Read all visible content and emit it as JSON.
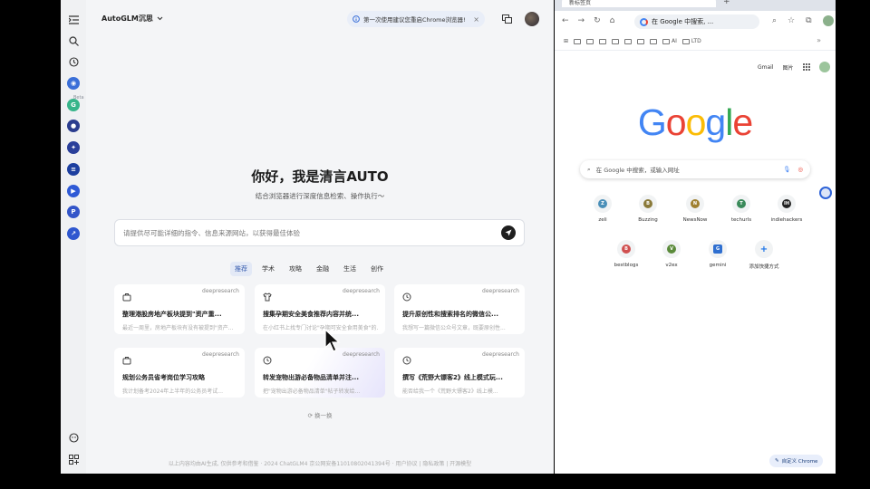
{
  "autoglm": {
    "title": "AutoGLM沉思",
    "notice": "第一次使用建议您重启Chrome浏览器!",
    "notice_close": "×",
    "rail_beta": "Beta",
    "hero_title": "你好，我是清言AUTO",
    "hero_sub": "结合浏览器进行深度信息检索、操作执行～",
    "prompt_placeholder": "请提供尽可能详细的指令、信息来源网站，以获得最佳体验",
    "categories": [
      "推荐",
      "学术",
      "攻略",
      "金融",
      "生活",
      "创作"
    ],
    "active_category": "推荐",
    "cards": [
      {
        "tag": "deepresearch",
        "icon": "briefcase-icon",
        "title": "整理港股房地产板块提到\"资产重...",
        "desc": "最近一周里，房地产板块有没有被提到\"资产..."
      },
      {
        "tag": "deepresearch",
        "icon": "shirt-icon",
        "title": "搜集孕期安全美食推荐内容并统...",
        "desc": "在小红书上找专门讨论\"孕期可安全食用美食\"的..."
      },
      {
        "tag": "deepresearch",
        "icon": "clock-icon",
        "title": "提升原创性和搜索排名的微信公...",
        "desc": "我想写一篇微信公众号文章，既要原创性..."
      },
      {
        "tag": "deepresearch",
        "icon": "briefcase-icon",
        "title": "规划公务员省考岗位学习攻略",
        "desc": "我计划备考2024年上半年的公务员考试..."
      },
      {
        "tag": "deepresearch",
        "icon": "clock-icon",
        "title": "转发宠物出游必备物品清单并注...",
        "desc": "把\"宠物出游必备物品清单\"帖子转发给..."
      },
      {
        "tag": "deepresearch",
        "icon": "clock-icon",
        "title": "撰写《荒野大镖客2》线上模式玩...",
        "desc": "能否给我一个《荒野大镖客2》线上模..."
      }
    ],
    "refresh_label": "换一换",
    "footer": "以上内容均由AI生成, 仅供参考和借鉴 · 2024 ChatGLM4 京公网安备11010802041394号 · 用户协议 | 隐私政策 | 开源模型"
  },
  "chrome": {
    "tab_title": "新标签页",
    "omnibox": "在 Google 中搜索, ...",
    "bookmarks": [
      "AI",
      "LTD"
    ],
    "gmail": "Gmail",
    "images": "图片",
    "logo_letters": [
      {
        "ch": "G",
        "color": "#4285F4"
      },
      {
        "ch": "o",
        "color": "#EA4335"
      },
      {
        "ch": "o",
        "color": "#FBBC05"
      },
      {
        "ch": "g",
        "color": "#4285F4"
      },
      {
        "ch": "l",
        "color": "#34A853"
      },
      {
        "ch": "e",
        "color": "#EA4335"
      }
    ],
    "search_placeholder": "在 Google 中搜索，或输入网址",
    "shortcuts": [
      {
        "label": "zeli",
        "letter": "Z",
        "color": "#4a8fb8"
      },
      {
        "label": "Buzzing",
        "letter": "B",
        "color": "#8a7a3a"
      },
      {
        "label": "NewsNow",
        "letter": "N",
        "color": "#a08030"
      },
      {
        "label": "techurls",
        "letter": "T",
        "color": "#3a8a5a"
      },
      {
        "label": "indiehackers",
        "letter": "IH",
        "color": "#222222"
      },
      {
        "label": "bestblogs",
        "letter": "B",
        "color": "#d05050"
      },
      {
        "label": "v2ex",
        "letter": "V",
        "color": "#5a8a3a"
      },
      {
        "label": "gemini",
        "letter": "G",
        "color": "#2f6fd0"
      },
      {
        "label": "添加快捷方式",
        "letter": "+",
        "color": "#1a73e8"
      }
    ],
    "customize_label": "自定义 Chrome"
  }
}
